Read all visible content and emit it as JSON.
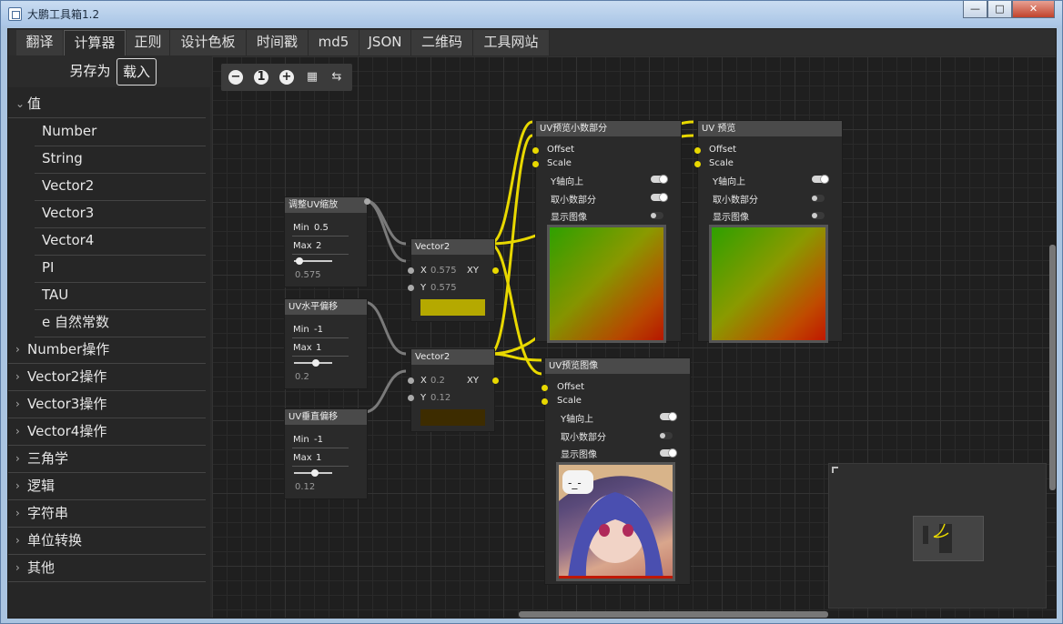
{
  "window": {
    "title": "大鹏工具箱1.2",
    "controls": {
      "minimize": "—",
      "maximize": "□",
      "close": "✕"
    }
  },
  "tabs": [
    "翻译",
    "计算器",
    "正则",
    "设计色板",
    "时间戳",
    "md5",
    "JSON",
    "二维码",
    "工具网站"
  ],
  "active_tab": "计算器",
  "sidebar": {
    "save_as": "另存为",
    "load": "载入",
    "tree": [
      {
        "label": "值",
        "expanded": true,
        "children": [
          "Number",
          "String",
          "Vector2",
          "Vector3",
          "Vector4",
          "PI",
          "TAU",
          "e 自然常数"
        ]
      },
      {
        "label": "Number操作"
      },
      {
        "label": "Vector2操作"
      },
      {
        "label": "Vector3操作"
      },
      {
        "label": "Vector4操作"
      },
      {
        "label": "三角学"
      },
      {
        "label": "逻辑"
      },
      {
        "label": "字符串"
      },
      {
        "label": "单位转换"
      },
      {
        "label": "其他"
      }
    ]
  },
  "canvas_toolbar": {
    "zoom_out": "−",
    "reset_zoom": "1",
    "zoom_in": "+"
  },
  "nodes": {
    "uv_scale": {
      "title": "调整UV缩放",
      "min_label": "Min",
      "min": "0.5",
      "max_label": "Max",
      "max": "2",
      "value": "0.575",
      "slider_fraction": 0.05
    },
    "uv_h_offset": {
      "title": "UV水平偏移",
      "min_label": "Min",
      "min": "-1",
      "max_label": "Max",
      "max": "1",
      "value": "0.2",
      "slider_fraction": 0.6
    },
    "uv_v_offset": {
      "title": "UV垂直偏移",
      "min_label": "Min",
      "min": "-1",
      "max_label": "Max",
      "max": "1",
      "value": "0.12",
      "slider_fraction": 0.56
    },
    "vector2_a": {
      "title": "Vector2",
      "x_label": "X",
      "x": "0.575",
      "y_label": "Y",
      "y": "0.575",
      "out": "XY",
      "swatch": "#b5a900"
    },
    "vector2_b": {
      "title": "Vector2",
      "x_label": "X",
      "x": "0.2",
      "y_label": "Y",
      "y": "0.12",
      "out": "XY",
      "swatch": "#3d2c00"
    },
    "uv_fraction_preview": {
      "title": "UV预览小数部分",
      "offset": "Offset",
      "scale": "Scale",
      "flip_y": "Y轴向上",
      "flip_y_on": true,
      "fraction": "取小数部分",
      "fraction_on": true,
      "show_image": "显示图像",
      "show_image_on": false
    },
    "uv_preview": {
      "title": "UV 预览",
      "offset": "Offset",
      "scale": "Scale",
      "flip_y": "Y轴向上",
      "flip_y_on": true,
      "fraction": "取小数部分",
      "fraction_on": false,
      "show_image": "显示图像",
      "show_image_on": false
    },
    "uv_image_preview": {
      "title": "UV预览图像",
      "offset": "Offset",
      "scale": "Scale",
      "flip_y": "Y轴向上",
      "flip_y_on": true,
      "fraction": "取小数部分",
      "fraction_on": false,
      "show_image": "显示图像",
      "show_image_on": true
    }
  },
  "colors": {
    "wire_active": "#e8d800",
    "wire_idle": "#7a7a7a",
    "accent": "#e0e0e0"
  }
}
